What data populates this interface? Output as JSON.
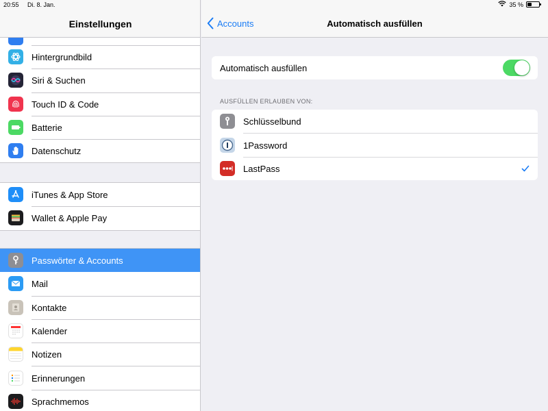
{
  "status_bar": {
    "time": "20:55",
    "date": "Di. 8. Jan.",
    "battery_text": "35 %",
    "battery_level": 0.35
  },
  "sidebar": {
    "title": "Einstellungen",
    "group1": [
      {
        "label": "Hintergrundbild",
        "icon": "wallpaper-icon",
        "color": "#33b0e6"
      },
      {
        "label": "Siri & Suchen",
        "icon": "siri-icon",
        "color": "#242436"
      },
      {
        "label": "Touch ID & Code",
        "icon": "fingerprint-icon",
        "color": "#f0344e"
      },
      {
        "label": "Batterie",
        "icon": "battery-icon",
        "color": "#4cd964"
      },
      {
        "label": "Datenschutz",
        "icon": "hand-icon",
        "color": "#2f7ef0"
      }
    ],
    "group2": [
      {
        "label": "iTunes & App Store",
        "icon": "app-store-icon",
        "color": "#1f8ef8"
      },
      {
        "label": "Wallet & Apple Pay",
        "icon": "wallet-icon",
        "color": "#1c1c1e"
      }
    ],
    "group3": [
      {
        "label": "Passwörter & Accounts",
        "icon": "key-icon",
        "color": "#8e8e93",
        "selected": true
      },
      {
        "label": "Mail",
        "icon": "mail-icon",
        "color": "#2b9bf4"
      },
      {
        "label": "Kontakte",
        "icon": "contacts-icon",
        "color": "#c9c3b9"
      },
      {
        "label": "Kalender",
        "icon": "calendar-icon",
        "color": "#ffffff"
      },
      {
        "label": "Notizen",
        "icon": "notes-icon",
        "color": "#ffffff"
      },
      {
        "label": "Erinnerungen",
        "icon": "reminders-icon",
        "color": "#ffffff"
      },
      {
        "label": "Sprachmemos",
        "icon": "voice-memos-icon",
        "color": "#1c1c1e"
      }
    ]
  },
  "detail": {
    "back_label": "Accounts",
    "title": "Automatisch ausfüllen",
    "autofill_label": "Automatisch ausfüllen",
    "autofill_on": true,
    "section_header": "AUSFÜLLEN ERLAUBEN VON:",
    "providers": [
      {
        "label": "Schlüsselbund",
        "icon": "keychain-icon",
        "checked": false
      },
      {
        "label": "1Password",
        "icon": "onepassword-icon",
        "checked": false
      },
      {
        "label": "LastPass",
        "icon": "lastpass-icon",
        "checked": true
      }
    ]
  },
  "colors": {
    "accent": "#1a7cf5",
    "selection": "#3f94f6",
    "toggle_on": "#4cd964"
  }
}
